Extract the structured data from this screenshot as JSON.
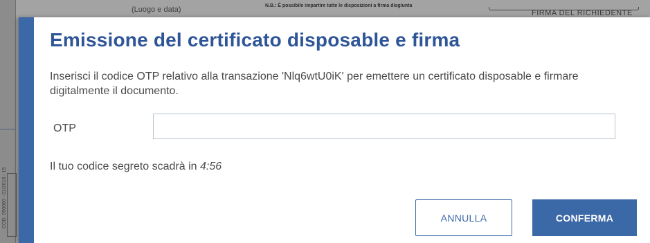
{
  "background_document": {
    "place_date_label": "(Luogo e data)",
    "note": "N.B.: È possibile impartire tutte le disposizioni a firma disgiunta",
    "signature_label": "FIRMA DEL RICHIEDENTE",
    "side_code": "COD. 050060 - 01/2018 - 15"
  },
  "modal": {
    "title": "Emissione del certificato disposable e firma",
    "description": "Inserisci il codice OTP relativo alla transazione 'Nlq6wtU0iK' per emettere un certificato disposable e firmare digitalmente il documento.",
    "otp": {
      "label": "OTP",
      "value": "",
      "placeholder": ""
    },
    "expiry": {
      "text": "Il tuo codice segreto scadrà in ",
      "time": "4:56"
    },
    "buttons": {
      "cancel": "ANNULLA",
      "confirm": "CONFERMA"
    }
  },
  "colors": {
    "accent": "#3b68a6",
    "title": "#2e5597"
  }
}
